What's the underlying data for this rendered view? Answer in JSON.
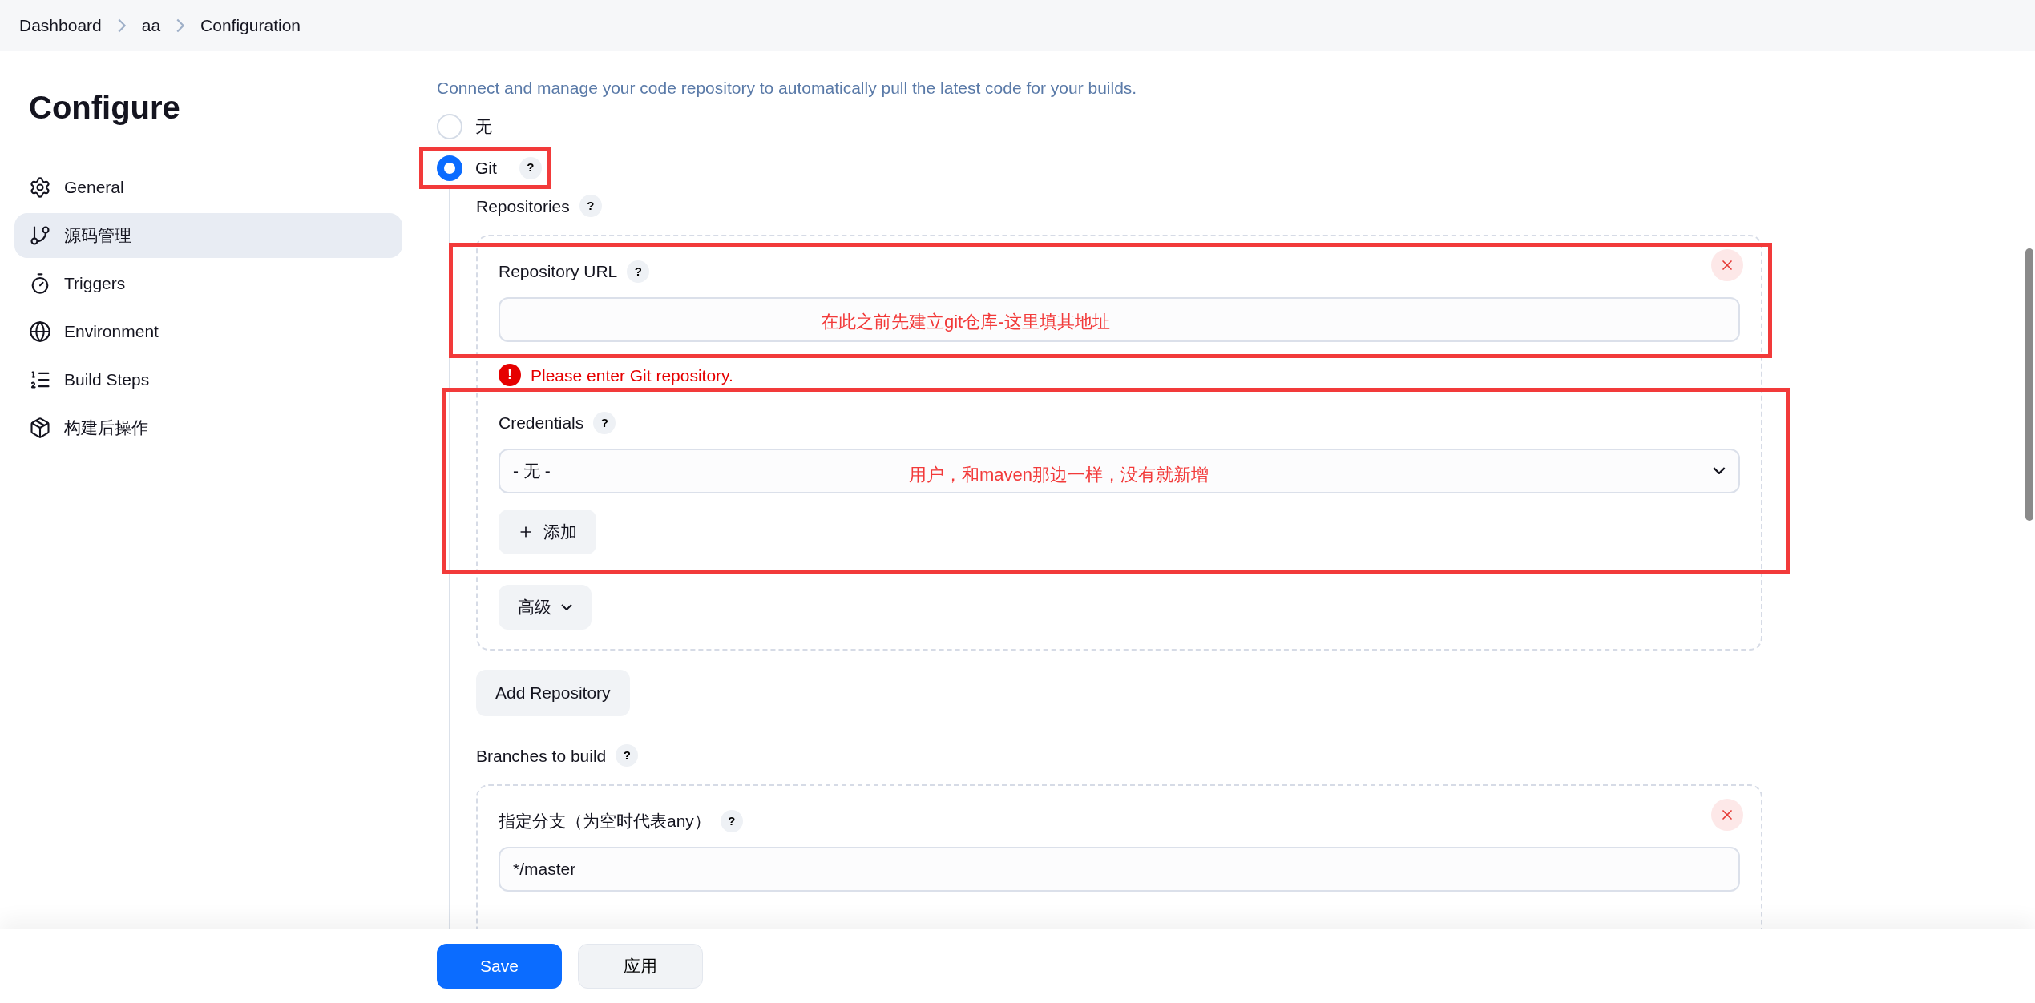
{
  "breadcrumbs": [
    {
      "label": "Dashboard"
    },
    {
      "label": "aa"
    },
    {
      "label": "Configuration"
    }
  ],
  "sidebar": {
    "title": "Configure",
    "items": [
      {
        "label": "General",
        "kind": "gear",
        "selected": false
      },
      {
        "label": "源码管理",
        "kind": "branch",
        "selected": true
      },
      {
        "label": "Triggers",
        "kind": "timer",
        "selected": false
      },
      {
        "label": "Environment",
        "kind": "globe",
        "selected": false
      },
      {
        "label": "Build Steps",
        "kind": "steps",
        "selected": false
      },
      {
        "label": "构建后操作",
        "kind": "package",
        "selected": false
      }
    ]
  },
  "scm": {
    "description": "Connect and manage your code repository to automatically pull the latest code for your builds.",
    "options": [
      {
        "label": "无",
        "selected": false,
        "annotated": false
      },
      {
        "label": "Git",
        "help": "?",
        "selected": true,
        "annotated": true
      }
    ],
    "repositories": {
      "label": "Repositories",
      "help": "?",
      "items": [
        {
          "url": {
            "label": "Repository URL",
            "help": "?",
            "annotation": "在此之前先建立git仓库-这里填其地址",
            "error_icon": "!",
            "error": "Please enter Git repository."
          },
          "credentials": {
            "label": "Credentials",
            "help": "?",
            "value": "- 无 -",
            "annotation": "用户，和maven那边一样，没有就新增",
            "add_button": "添加"
          },
          "advanced_button": "高级"
        }
      ]
    },
    "add_repository_button": "Add Repository",
    "branches": {
      "label": "Branches to build",
      "help": "?",
      "items": [
        {
          "label": "指定分支（为空时代表any）",
          "help": "?",
          "value": "*/master"
        }
      ]
    }
  },
  "footer": {
    "buttons": [
      {
        "label": "Save",
        "kind": "primary"
      },
      {
        "label": "应用",
        "kind": "secondary"
      }
    ]
  }
}
